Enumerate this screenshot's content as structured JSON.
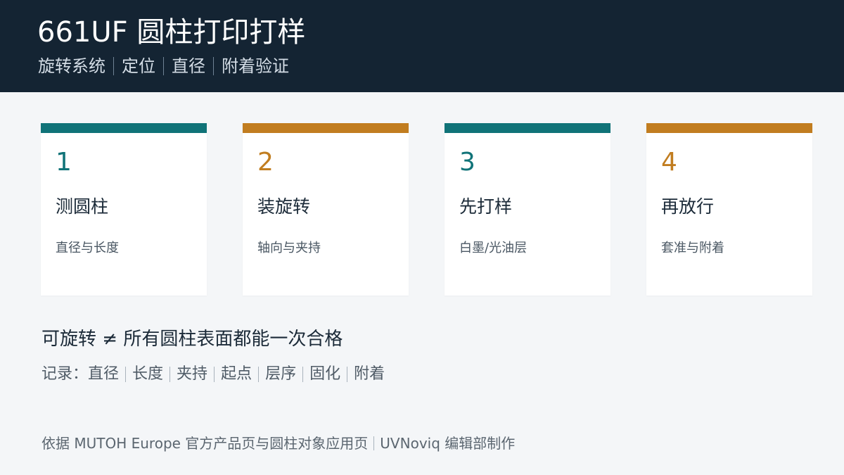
{
  "header": {
    "title": "661UF 圆柱打印打样",
    "subtitle_items": [
      "旋转系统",
      "定位",
      "直径",
      "附着验证"
    ]
  },
  "cards": [
    {
      "number": "1",
      "title": "测圆柱",
      "desc": "直径与长度",
      "accent": "#107378"
    },
    {
      "number": "2",
      "title": "装旋转",
      "desc": "轴向与夹持",
      "accent": "#c17d20"
    },
    {
      "number": "3",
      "title": "先打样",
      "desc": "白墨/光油层",
      "accent": "#107378"
    },
    {
      "number": "4",
      "title": "再放行",
      "desc": "套准与附着",
      "accent": "#c17d20"
    }
  ],
  "note": "可旋转 ≠ 所有圆柱表面都能一次合格",
  "record": {
    "label": "记录：",
    "items": [
      "直径",
      "长度",
      "夹持",
      "起点",
      "层序",
      "固化",
      "附着"
    ]
  },
  "footer": {
    "source": "依据 MUTOH Europe 官方产品页与圆柱对象应用页",
    "credit": "UVNoviq 编辑部制作"
  },
  "colors": {
    "header_bg": "#142433",
    "teal": "#107378",
    "amber": "#c17d20",
    "page_bg": "#f4f6f8"
  }
}
